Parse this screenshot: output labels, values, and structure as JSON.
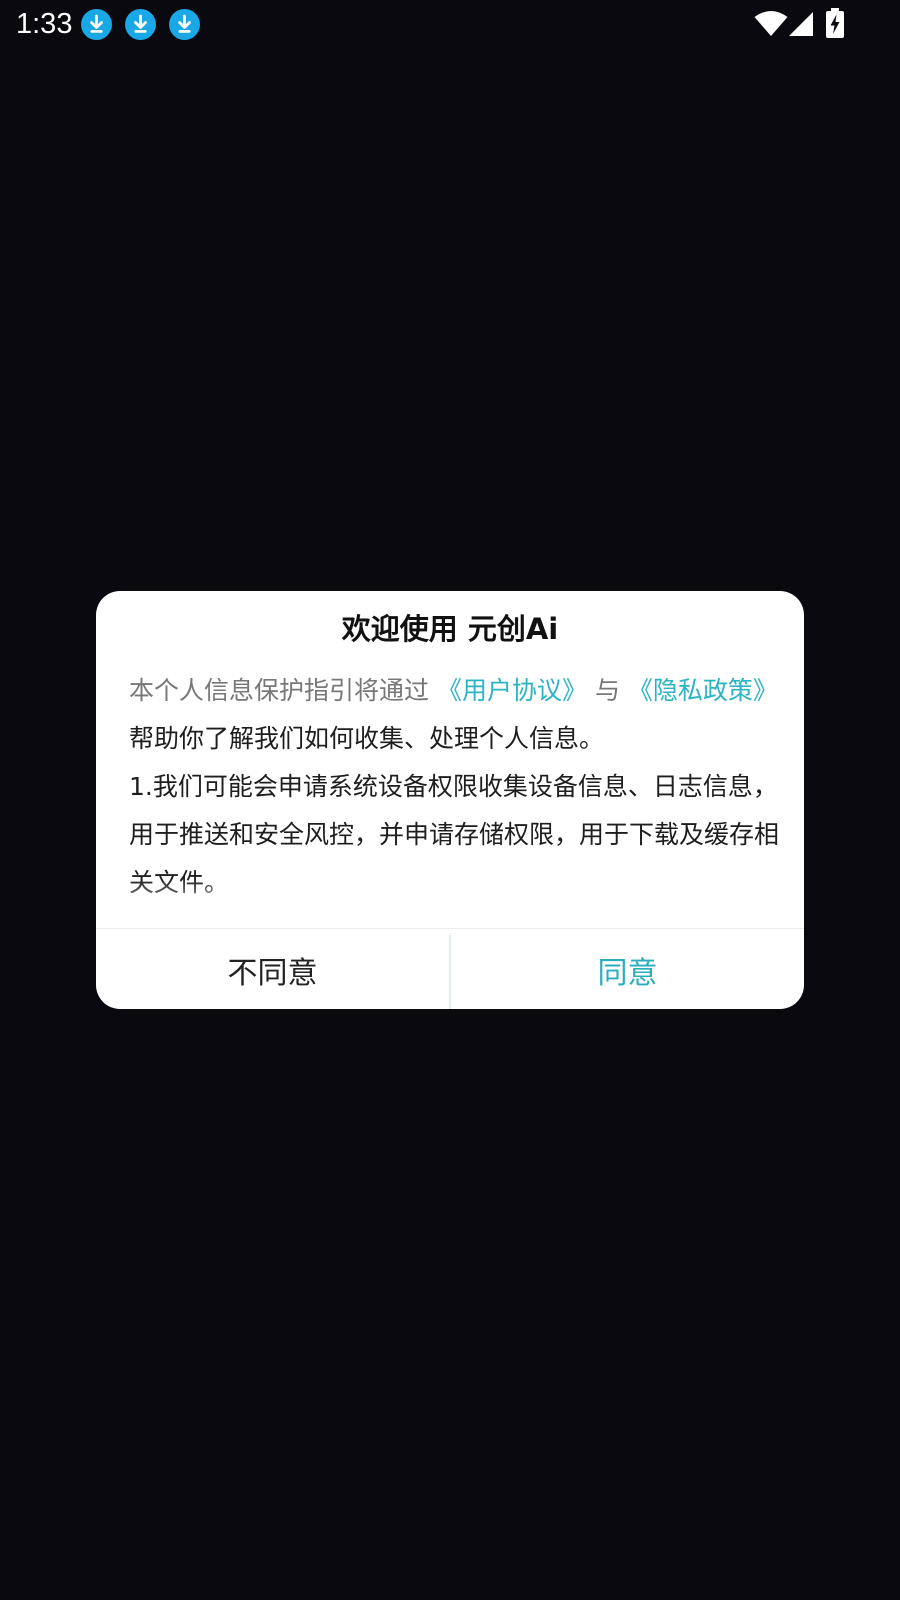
{
  "status_bar": {
    "time": "1:33",
    "icons": [
      "download-icon",
      "download-icon",
      "download-icon",
      "wifi-icon",
      "signal-icon",
      "battery-charging-icon"
    ],
    "download_color": "#1aa7e6"
  },
  "dialog": {
    "title": "欢迎使用 元创Ai",
    "intro": {
      "prefix": "本个人信息保护指引将通过",
      "user_agreement_link": "《用户协议》",
      "connector": "与",
      "privacy_policy_link": "《隐私政策》",
      "suffix": "帮助你了解我们如何收集、处理个人信息。"
    },
    "item_1": "1.我们可能会申请系统设备权限收集设备信息、日志信息，用于推送和安全风控，并申请存储权限，用于下载及缓存相关文件。",
    "buttons": {
      "disagree": "不同意",
      "agree": "同意"
    },
    "accent_color": "#2aaebe"
  }
}
